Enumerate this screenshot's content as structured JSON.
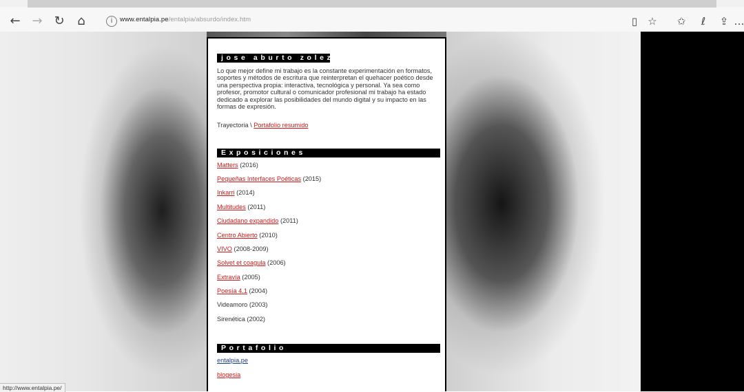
{
  "browser": {
    "url_host": "www.entalpia.pe",
    "url_path": "/entalpia/absurdo/index.htm",
    "status_url": "http://www.entalpia.pe/"
  },
  "page": {
    "name_heading": "jose aburto zolezzi",
    "bio": "Lo que mejor define mi trabajo es la constante experimentación en formatos, soportes y métodos de escritura que reinterpretan el quehacer poético desde una perspectiva propia: interactiva, tecnológica y personal. Ya sea como profesor, promotor cultural o comunicador profesional mi trabajo ha estado dedicado a explorar las posibilidades del mundo digital y su impacto en las formas de expresión.",
    "trayectoria_label": "Trayectoria \\ ",
    "trayectoria_link": "Portafolio resumido",
    "exposiciones_heading": "Exposiciones",
    "exposiciones": [
      {
        "title": "Matters",
        "year": " (2016)",
        "linked": true
      },
      {
        "title": "Pequeñas Interfaces Poéticas",
        "year": " (2015)",
        "linked": true
      },
      {
        "title": "Inkarri",
        "year": " (2014)",
        "linked": true
      },
      {
        "title": "Multitudes",
        "year": " (2011)",
        "linked": true
      },
      {
        "title": "Ciudadano expandido",
        "year": " (2011)",
        "linked": true
      },
      {
        "title": "Centro Abierto",
        "year": " (2010)",
        "linked": true
      },
      {
        "title": "VIVO",
        "year": " (2008-2009)",
        "linked": true
      },
      {
        "title": "Solvet et coagula",
        "year": " (2006)",
        "linked": true
      },
      {
        "title": "Extravía",
        "year": " (2005)",
        "linked": true
      },
      {
        "title": "Poesía 4.1",
        "year": " (2004)",
        "linked": true
      },
      {
        "title": "Videamoro",
        "year": " (2003)",
        "linked": false
      },
      {
        "title": "Sirenética",
        "year": " (2002)",
        "linked": false
      }
    ],
    "portafolio_heading": "Portafolio",
    "portafolio": [
      {
        "label": "entalpia.pe",
        "color": "#1d3f8a"
      },
      {
        "label": "blogesia",
        "color": "#cc1a1a"
      }
    ]
  },
  "colors": {
    "link_red": "#cc1a1a",
    "link_blue": "#1d3f8a"
  }
}
